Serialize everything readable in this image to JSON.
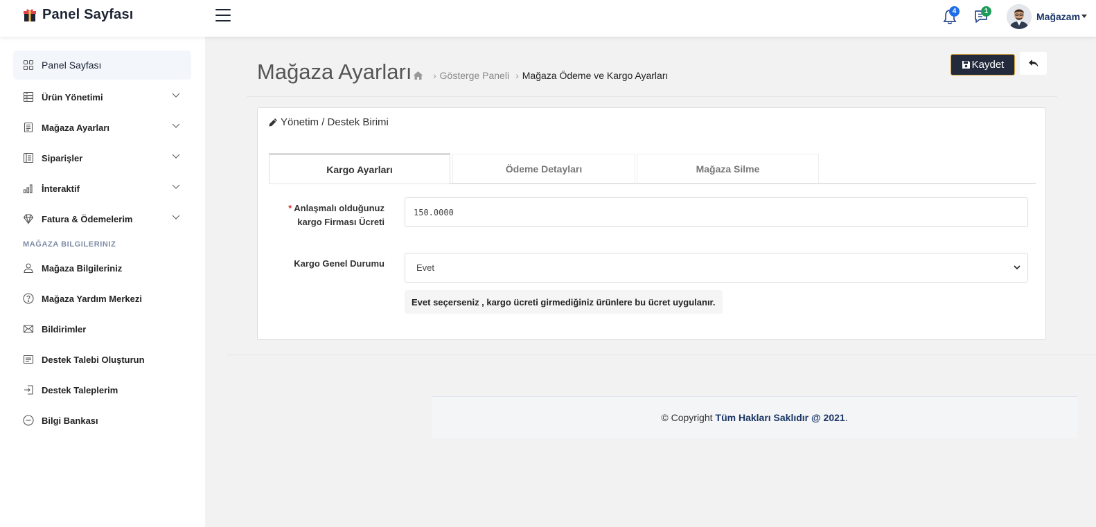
{
  "header": {
    "brand": "Panel Sayfası",
    "notifications_count": "4",
    "messages_count": "1",
    "user_name": "Mağazam",
    "icons": {
      "brand": "gift-shop-icon",
      "menu": "hamburger-icon",
      "notifications": "bell-icon",
      "messages": "chat-icon"
    },
    "colors": {
      "notif_badge": "#1e6ee8",
      "msg_badge": "#1d9b5a",
      "user": "#1a3566"
    }
  },
  "sidebar": {
    "items": [
      {
        "label": "Panel Sayfası",
        "icon": "grid-icon",
        "expandable": false,
        "active": true
      },
      {
        "label": "Ürün Yönetimi",
        "icon": "server-icon",
        "expandable": true
      },
      {
        "label": "Mağaza Ayarları",
        "icon": "document-icon",
        "expandable": true
      },
      {
        "label": "Siparişler",
        "icon": "list-icon",
        "expandable": true
      },
      {
        "label": "İnteraktif",
        "icon": "bar-chart-icon",
        "expandable": true
      },
      {
        "label": "Fatura & Ödemelerim",
        "icon": "diamond-icon",
        "expandable": true
      }
    ],
    "section_title": "MAĞAZA BILGILERINIZ",
    "section_items": [
      {
        "label": "Mağaza Bilgileriniz",
        "icon": "user-icon"
      },
      {
        "label": "Mağaza Yardım Merkezi",
        "icon": "question-icon"
      },
      {
        "label": "Bildirimler",
        "icon": "mail-icon"
      },
      {
        "label": "Destek Talebi Oluşturun",
        "icon": "ticket-icon"
      },
      {
        "label": "Destek Taleplerim",
        "icon": "login-icon"
      },
      {
        "label": "Bilgi Bankası",
        "icon": "minus-circle-icon"
      }
    ]
  },
  "main": {
    "title": "Mağaza Ayarları",
    "breadcrumb": {
      "home_icon": "home-icon",
      "items": [
        "Gösterge Paneli",
        "Mağaza Ödeme ve Kargo Ayarları"
      ]
    },
    "save_label": "Kaydet",
    "save_icon": "floppy-icon",
    "back_icon": "reply-icon",
    "card_title": "Yönetim / Destek Birimi",
    "card_icon": "pencil-icon",
    "tabs": [
      {
        "label": "Kargo Ayarları",
        "active": true
      },
      {
        "label": "Ödeme Detayları",
        "active": false
      },
      {
        "label": "Mağaza Silme",
        "active": false
      }
    ],
    "form": {
      "required_mark": "*",
      "shipping_fee_label": "Anlaşmalı olduğunuz kargo Firması Ücreti",
      "shipping_fee_value": "150.0000",
      "status_label": "Kargo Genel Durumu",
      "status_value": "Evet",
      "help_text": "Evet seçerseniz , kargo ücreti girmediğiniz ürünlere bu ücret uygulanır."
    }
  },
  "footer": {
    "copyright": "© Copyright",
    "rights": "Tüm Hakları Saklıdır @ 2021",
    "period": "."
  }
}
